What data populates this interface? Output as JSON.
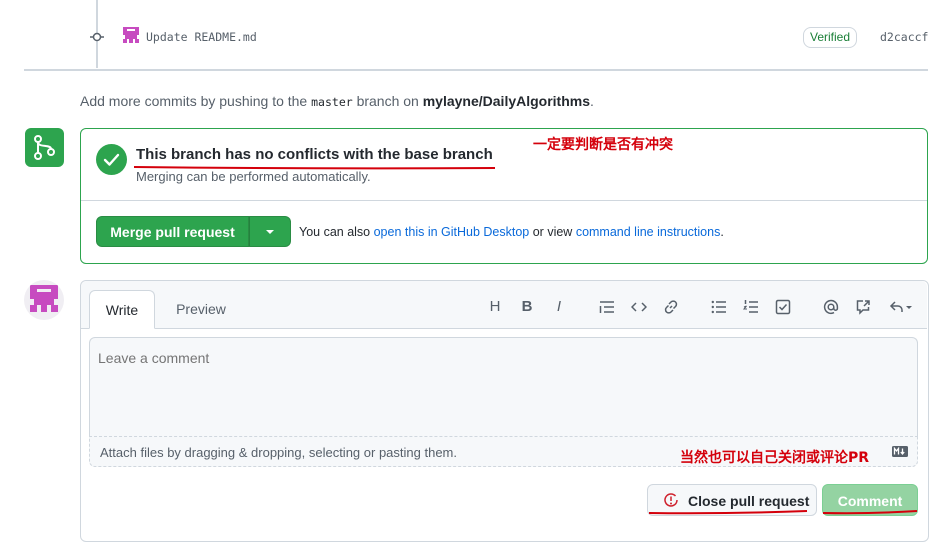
{
  "commit": {
    "message": "Update README.md",
    "verified": "Verified",
    "sha": "d2caccf"
  },
  "add_commits": {
    "prefix": "Add more commits by pushing to the",
    "branch": "master",
    "middle": "branch on",
    "repo": "mylayne/DailyAlgorithms",
    "suffix": "."
  },
  "merge": {
    "title": "This branch has no conflicts with the base branch",
    "subtitle": "Merging can be performed automatically.",
    "button": "Merge pull request",
    "also_prefix": "You can also",
    "desktop_link": "open this in GitHub Desktop",
    "or_view": "or view",
    "cli_link": "command line instructions",
    "period": "."
  },
  "annotations": {
    "conflict_note": "一定要判断是否有冲突",
    "close_note": "当然也可以自己关闭或评论PR"
  },
  "comment": {
    "tab_write": "Write",
    "tab_preview": "Preview",
    "placeholder": "Leave a comment",
    "attach": "Attach files by dragging & dropping, selecting or pasting them.",
    "close_button": "Close pull request",
    "comment_button": "Comment"
  },
  "toolbar": {
    "heading": "H",
    "bold": "B",
    "italic": "I"
  },
  "colors": {
    "success": "#2da44e",
    "annotation": "#d4000b",
    "link": "#0969da"
  }
}
